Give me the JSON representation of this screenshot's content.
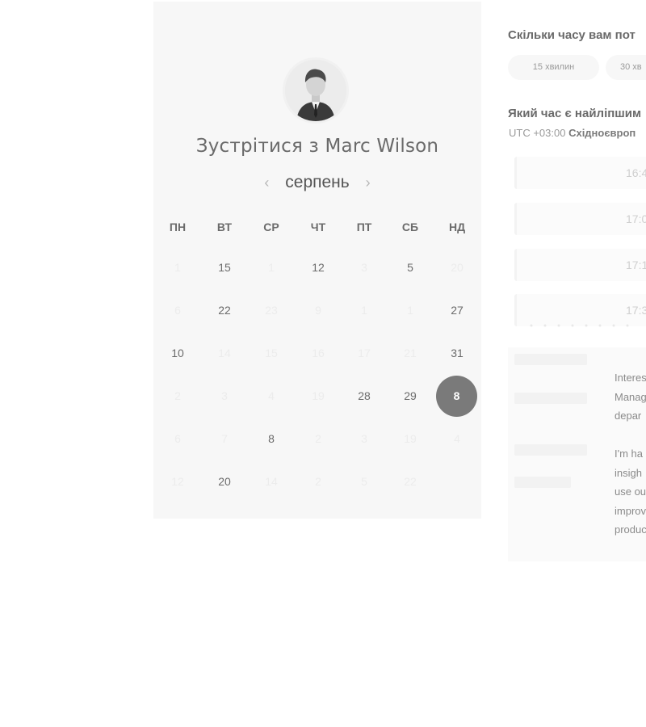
{
  "meeting": {
    "title_prefix": "Зустрітися з",
    "host_name": "Marc Wilson",
    "avatar_icon": "person-photo-icon"
  },
  "calendar": {
    "month": "серпень",
    "prev_icon": "chevron-left-icon",
    "next_icon": "chevron-right-icon",
    "weekdays": [
      "ПН",
      "ВТ",
      "СР",
      "ЧТ",
      "ПТ",
      "СБ",
      "НД"
    ],
    "weeks": [
      [
        {
          "d": "1",
          "s": "muted"
        },
        {
          "d": "15",
          "s": "active"
        },
        {
          "d": "1",
          "s": "muted"
        },
        {
          "d": "12",
          "s": "active"
        },
        {
          "d": "3",
          "s": "muted"
        },
        {
          "d": "5",
          "s": "active"
        },
        {
          "d": "20",
          "s": "muted"
        }
      ],
      [
        {
          "d": "6",
          "s": "muted"
        },
        {
          "d": "22",
          "s": "active"
        },
        {
          "d": "23",
          "s": "muted"
        },
        {
          "d": "9",
          "s": "muted"
        },
        {
          "d": "1",
          "s": "muted"
        },
        {
          "d": "1",
          "s": "muted"
        },
        {
          "d": "27",
          "s": "active"
        }
      ],
      [
        {
          "d": "10",
          "s": "active"
        },
        {
          "d": "14",
          "s": "muted"
        },
        {
          "d": "15",
          "s": "muted"
        },
        {
          "d": "16",
          "s": "muted"
        },
        {
          "d": "17",
          "s": "muted"
        },
        {
          "d": "21",
          "s": "muted"
        },
        {
          "d": "31",
          "s": "active"
        }
      ],
      [
        {
          "d": "2",
          "s": "muted"
        },
        {
          "d": "3",
          "s": "muted"
        },
        {
          "d": "4",
          "s": "muted"
        },
        {
          "d": "19",
          "s": "muted"
        },
        {
          "d": "28",
          "s": "active"
        },
        {
          "d": "29",
          "s": "active"
        },
        {
          "d": "8",
          "s": "selected"
        }
      ],
      [
        {
          "d": "6",
          "s": "muted"
        },
        {
          "d": "7",
          "s": "muted"
        },
        {
          "d": "8",
          "s": "active"
        },
        {
          "d": "2",
          "s": "muted"
        },
        {
          "d": "3",
          "s": "muted"
        },
        {
          "d": "19",
          "s": "muted"
        },
        {
          "d": "4",
          "s": "muted"
        }
      ],
      [
        {
          "d": "12",
          "s": "muted"
        },
        {
          "d": "20",
          "s": "active"
        },
        {
          "d": "14",
          "s": "muted"
        },
        {
          "d": "2",
          "s": "muted"
        },
        {
          "d": "5",
          "s": "muted"
        },
        {
          "d": "22",
          "s": "muted"
        },
        {
          "d": "",
          "s": "muted"
        }
      ]
    ]
  },
  "duration": {
    "question": "Скільки часу вам пот",
    "options": [
      "15 хвилин",
      "30 хв"
    ]
  },
  "time_selection": {
    "question": "Який час є найліпшим",
    "timezone_offset": "UTC +03:00",
    "timezone_name": "Східноєвроп",
    "slots": [
      "16:4",
      "17:0",
      "17:1",
      "17:3"
    ]
  },
  "description": {
    "para1": [
      "Interes",
      "Manag",
      "depar"
    ],
    "para2": [
      "I'm ha",
      "insigh",
      "use ou",
      "improv",
      "produc"
    ]
  }
}
